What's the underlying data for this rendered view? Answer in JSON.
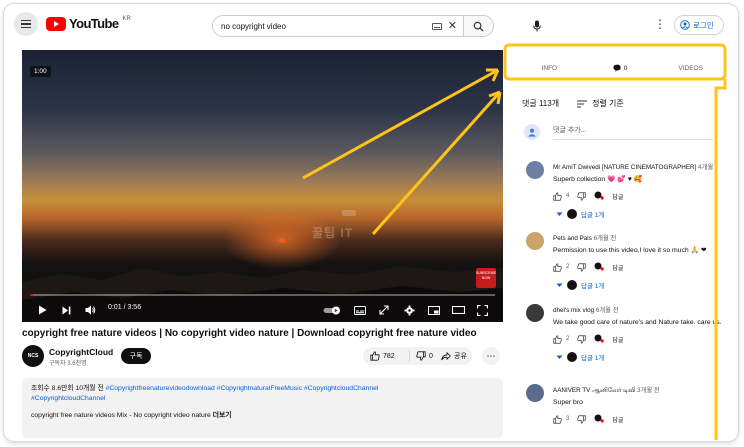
{
  "header": {
    "logo_text": "YouTube",
    "region": "KR",
    "search_value": "no copyright video",
    "signin_label": "로그인",
    "icons": [
      "menu-icon",
      "keyboard-icon",
      "clear-icon",
      "search-icon",
      "mic-icon",
      "more-vert-icon",
      "account-icon"
    ]
  },
  "player": {
    "duration_chip": "1:00",
    "current_time": "0:01 / 3:56",
    "progress_fraction": 0.004,
    "watermark": "꿀팁 IT",
    "badge_text": "SUBSCRIBE NOW",
    "icons": [
      "play-icon",
      "next-icon",
      "volume-icon",
      "autoplay-toggle-icon",
      "subtitles-icon",
      "fullscreen-arrows-icon",
      "settings-icon",
      "miniplayer-icon",
      "theater-icon",
      "fullscreen-icon"
    ]
  },
  "video": {
    "title": "copyright free nature videos | No copyright video nature | Download copyright free nature video",
    "channel": "CopyrightCloud",
    "channel_avatar_text": "NCS",
    "subscribers": "구독자 3.6천명",
    "subscribe_label": "구독",
    "like_count": "782",
    "dislike_count": "0",
    "share_label": "공유",
    "description_meta": "조회수 8.6만회  10개월 전",
    "description_tags_inline": "#Copyrightfreenaturevideodownload #CopyrightnaturalFreeMusic #CopyrightcloudChannel",
    "description_tags_line2": "#CopyrightcloudChannel",
    "description_line2": "copyright free nature videos Mix - No copyright video nature",
    "description_more": "더보기"
  },
  "panel": {
    "tabs": [
      {
        "label": "INFO",
        "icon": ""
      },
      {
        "label": "0",
        "icon": "comment-bubble-icon"
      },
      {
        "label": "VIDEOS",
        "icon": ""
      }
    ],
    "active_tab": 1,
    "comment_count": "댓글 113개",
    "sort_label": "정렬 기준",
    "add_placeholder": "댓글 추가...",
    "colors": {
      "accent": "#ff0000",
      "highlight": "#fec518",
      "link": "#065fd4"
    }
  },
  "comments": [
    {
      "author": "Mr AmiT Dwivedi [NATURE CINEMATOGRAPHER]",
      "time": "4개월",
      "text": "Superb collection 💗 💕 ♥ 🥰",
      "likes": "4",
      "reply_label": "답글",
      "replies": "답글 1개",
      "avatar_color": "#6e7fa6"
    },
    {
      "author": "Pets and Pals",
      "time": "6개월 전",
      "text": "Permission to use this video,I love it so much 🙏 ❤",
      "likes": "2",
      "reply_label": "답글",
      "replies": "답글 1개",
      "avatar_color": "#c9a56a"
    },
    {
      "author": "dhel's mix vlog",
      "time": "6개월 전",
      "text": "We take good care of nature's and Nature take. care us.",
      "likes": "2",
      "reply_label": "답글",
      "replies": "답글 1개",
      "avatar_color": "#3a3a3a"
    },
    {
      "author": "AANIVER TV ஆனிவேர் டிவி",
      "time": "3개월 전",
      "text": "Super bro",
      "likes": "3",
      "reply_label": "답글",
      "replies": "",
      "avatar_color": "#5b6b8c"
    }
  ]
}
